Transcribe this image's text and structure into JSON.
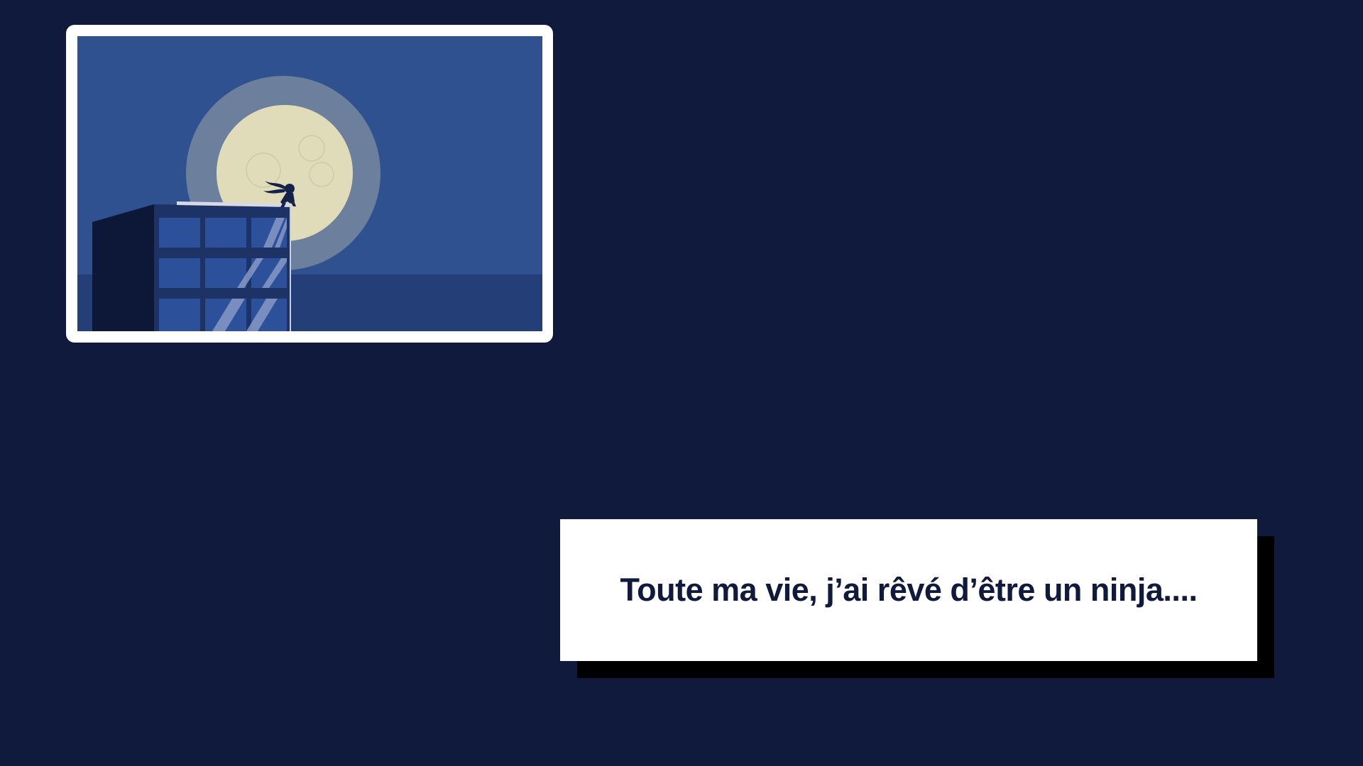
{
  "scene": {
    "background_color": "#101a3c",
    "illustration": {
      "subject": "ninja-on-rooftop-under-full-moon",
      "sky_color": "#2f5190",
      "moon_color": "#e0dcb9",
      "moon_halo_color": "#6c7f9c",
      "building_color": "#1d3366"
    },
    "caption": {
      "text": "Toute ma vie, j’ai rêvé d’être un ninja...."
    }
  }
}
